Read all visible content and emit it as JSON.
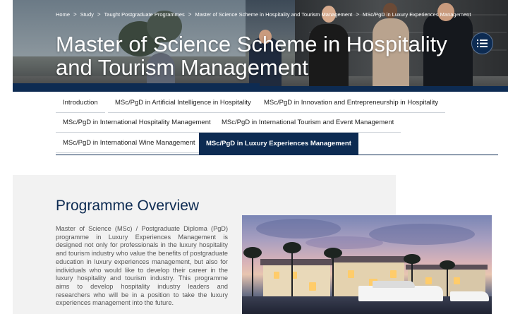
{
  "breadcrumb": {
    "items": [
      "Home",
      "Study",
      "Taught Postgraduate Programmes",
      "Master of Science Scheme in Hospitality and Tourism Management",
      "MSc/PgD in Luxury Experiences Management"
    ],
    "separator": ">"
  },
  "hero": {
    "title_line1": "Master of Science Scheme in Hospitality",
    "title_line2": "and Tourism Management",
    "menu_icon": "list-icon"
  },
  "tabs": [
    "Introduction",
    "MSc/PgD in Artificial Intelligence in Hospitality",
    "MSc/PgD in Innovation and Entrepreneurship in Hospitality",
    "MSc/PgD in International Hospitality Management",
    "MSc/PgD in International Tourism and Event Management",
    "MSc/PgD in International Wine Management",
    "MSc/PgD in Luxury Experiences Management"
  ],
  "active_tab": "MSc/PgD in Luxury Experiences Management",
  "overview": {
    "heading": "Programme Overview",
    "body": "Master of Science (MSc) / Postgraduate Diploma (PgD) programme in Luxury Experiences Management is designed not only for professionals in the luxury hospitality and tourism industry who value the benefits of postgraduate education in luxury experiences management, but also for individuals who would like to develop their career in the luxury hospitality and tourism industry. This programme aims to develop hospitality industry leaders and researchers who will be in a position to take the luxury experiences management into the future."
  },
  "colors": {
    "brand_navy": "#0d2b52",
    "panel_gray": "#f2f2f2"
  }
}
